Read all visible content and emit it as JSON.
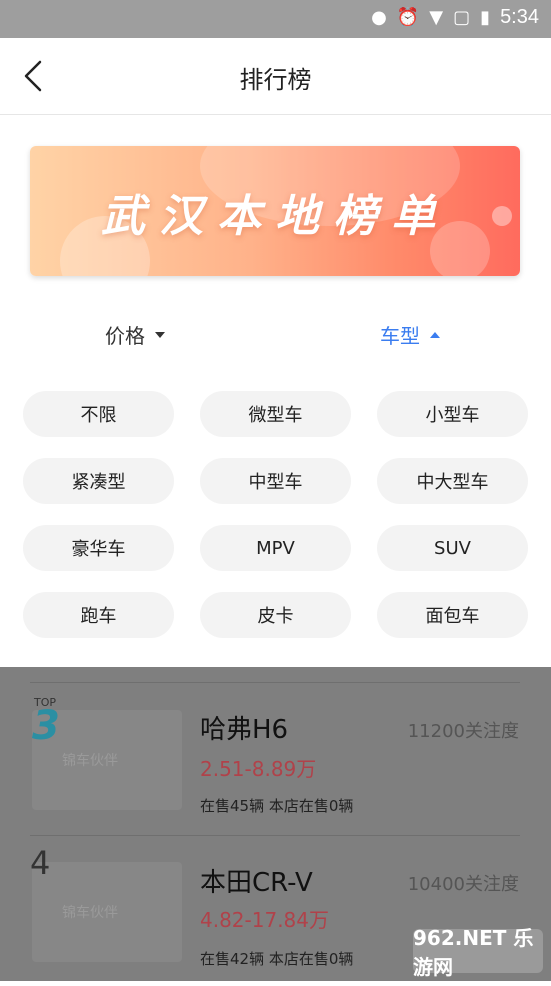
{
  "status_bar": {
    "time": "5:34",
    "icons": [
      "location-icon",
      "alarm-icon",
      "wifi-icon",
      "sim-icon",
      "battery-icon"
    ]
  },
  "header": {
    "title": "排行榜"
  },
  "banner": {
    "text": "武汉本地榜单"
  },
  "filters": {
    "price": "价格",
    "type": "车型"
  },
  "car_types": [
    "不限",
    "微型车",
    "小型车",
    "紧凑型",
    "中型车",
    "中大型车",
    "豪华车",
    "MPV",
    "SUV",
    "跑车",
    "皮卡",
    "面包车"
  ],
  "rankings": [
    {
      "top_label": "TOP",
      "rank": "3",
      "name": "哈弗H6",
      "price": "2.51-8.89万",
      "stock": "在售45辆 本店在售0辆",
      "heat": "11200关注度",
      "logo": "锦车伙伴"
    },
    {
      "rank": "4",
      "name": "本田CR-V",
      "price": "4.82-17.84万",
      "stock": "在售42辆 本店在售0辆",
      "heat": "10400关注度",
      "logo": "锦车伙伴"
    }
  ],
  "watermark": "962.NET 乐游网",
  "colors": {
    "accent_blue": "#3b7df0",
    "price_red": "#b0424a",
    "banner_start": "#ffd3a6",
    "banner_end": "#ff6b5e"
  }
}
